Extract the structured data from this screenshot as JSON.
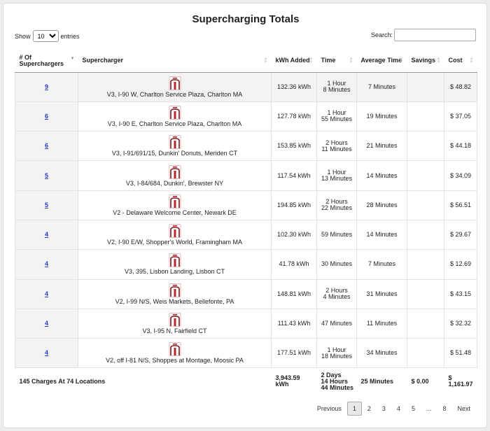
{
  "title": "Supercharging Totals",
  "length": {
    "show_label": "Show",
    "entries_label": "entries",
    "selected": "10"
  },
  "search": {
    "label": "Search:",
    "value": ""
  },
  "columns": [
    "# Of Superchargers",
    "Supercharger",
    "kWh Added",
    "Time",
    "Average Time",
    "Savings",
    "Cost"
  ],
  "rows": [
    {
      "count": "9",
      "name": "V3, I-90 W, Charlton Service Plaza, Charlton MA",
      "kwh": "132.36 kWh",
      "time": [
        "1 Hour",
        "8 Minutes"
      ],
      "avg": "7 Minutes",
      "savings": "",
      "cost": "$ 48.82"
    },
    {
      "count": "6",
      "name": "V3, I-90 E, Charlton Service Plaza, Charlton MA",
      "kwh": "127.78 kWh",
      "time": [
        "1 Hour",
        "55 Minutes"
      ],
      "avg": "19 Minutes",
      "savings": "",
      "cost": "$ 37.05"
    },
    {
      "count": "6",
      "name": "V3, I-91/691/15, Dunkin' Donuts, Meriden CT",
      "kwh": "153.85 kWh",
      "time": [
        "2 Hours",
        "11 Minutes"
      ],
      "avg": "21 Minutes",
      "savings": "",
      "cost": "$ 44.18"
    },
    {
      "count": "5",
      "name": "V3, I-84/684, Dunkin', Brewster NY",
      "kwh": "117.54 kWh",
      "time": [
        "1 Hour",
        "13 Minutes"
      ],
      "avg": "14 Minutes",
      "savings": "",
      "cost": "$ 34.09"
    },
    {
      "count": "5",
      "name": "V2 - Delaware Welcome Center, Newark DE",
      "kwh": "194.85 kWh",
      "time": [
        "2 Hours",
        "22 Minutes"
      ],
      "avg": "28 Minutes",
      "savings": "",
      "cost": "$ 56.51"
    },
    {
      "count": "4",
      "name": "V2, I-90 E/W, Shopper's World, Framingham MA",
      "kwh": "102.30 kWh",
      "time": [
        "59 Minutes"
      ],
      "avg": "14 Minutes",
      "savings": "",
      "cost": "$ 29.67"
    },
    {
      "count": "4",
      "name": "V3, 395, Lisbon Landing, Lisbon CT",
      "kwh": "41.78 kWh",
      "time": [
        "30 Minutes"
      ],
      "avg": "7 Minutes",
      "savings": "",
      "cost": "$ 12.69"
    },
    {
      "count": "4",
      "name": "V2, I-99 N/S, Weis Markets, Bellefonte, PA",
      "kwh": "148.81 kWh",
      "time": [
        "2 Hours",
        "4 Minutes"
      ],
      "avg": "31 Minutes",
      "savings": "",
      "cost": "$ 43.15"
    },
    {
      "count": "4",
      "name": "V3, I-95 N, Fairfield CT",
      "kwh": "111.43 kWh",
      "time": [
        "47 Minutes"
      ],
      "avg": "11 Minutes",
      "savings": "",
      "cost": "$ 32.32"
    },
    {
      "count": "4",
      "name": "V2, off I-81 N/S, Shoppes at Montage, Moosic PA",
      "kwh": "177.51 kWh",
      "time": [
        "1 Hour",
        "18 Minutes"
      ],
      "avg": "34 Minutes",
      "savings": "",
      "cost": "$ 51.48"
    }
  ],
  "footer": {
    "summary": "145 Charges At 74 Locations",
    "kwh": [
      "3,943.59",
      "kWh"
    ],
    "time": [
      "2 Days",
      "14 Hours",
      "44 Minutes"
    ],
    "avg": "25 Minutes",
    "savings": "$ 0.00",
    "cost": "$ 1,161.97"
  },
  "pagination": {
    "previous": "Previous",
    "pages": [
      "1",
      "2",
      "3",
      "4",
      "5",
      "...",
      "8"
    ],
    "current": "1",
    "next": "Next"
  },
  "colors": {
    "link": "#2a3cc9",
    "icon": "#b5252b",
    "sorted_bg": "#f3f3f3"
  },
  "icons": {
    "row": "tesla-supercharger-icon"
  }
}
